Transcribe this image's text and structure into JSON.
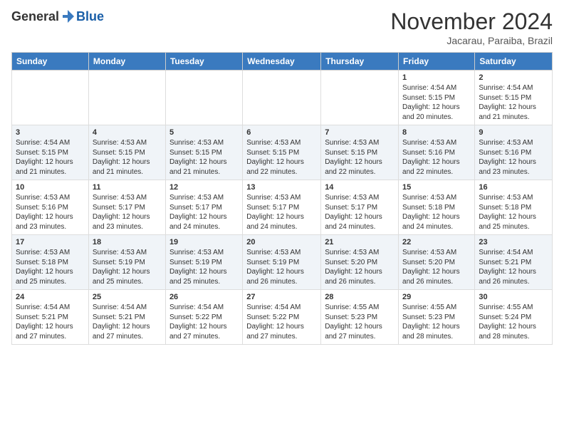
{
  "header": {
    "logo_general": "General",
    "logo_blue": "Blue",
    "month_title": "November 2024",
    "location": "Jacarau, Paraiba, Brazil"
  },
  "weekdays": [
    "Sunday",
    "Monday",
    "Tuesday",
    "Wednesday",
    "Thursday",
    "Friday",
    "Saturday"
  ],
  "weeks": [
    [
      {
        "day": "",
        "info": ""
      },
      {
        "day": "",
        "info": ""
      },
      {
        "day": "",
        "info": ""
      },
      {
        "day": "",
        "info": ""
      },
      {
        "day": "",
        "info": ""
      },
      {
        "day": "1",
        "info": "Sunrise: 4:54 AM\nSunset: 5:15 PM\nDaylight: 12 hours\nand 20 minutes."
      },
      {
        "day": "2",
        "info": "Sunrise: 4:54 AM\nSunset: 5:15 PM\nDaylight: 12 hours\nand 21 minutes."
      }
    ],
    [
      {
        "day": "3",
        "info": "Sunrise: 4:54 AM\nSunset: 5:15 PM\nDaylight: 12 hours\nand 21 minutes."
      },
      {
        "day": "4",
        "info": "Sunrise: 4:53 AM\nSunset: 5:15 PM\nDaylight: 12 hours\nand 21 minutes."
      },
      {
        "day": "5",
        "info": "Sunrise: 4:53 AM\nSunset: 5:15 PM\nDaylight: 12 hours\nand 21 minutes."
      },
      {
        "day": "6",
        "info": "Sunrise: 4:53 AM\nSunset: 5:15 PM\nDaylight: 12 hours\nand 22 minutes."
      },
      {
        "day": "7",
        "info": "Sunrise: 4:53 AM\nSunset: 5:15 PM\nDaylight: 12 hours\nand 22 minutes."
      },
      {
        "day": "8",
        "info": "Sunrise: 4:53 AM\nSunset: 5:16 PM\nDaylight: 12 hours\nand 22 minutes."
      },
      {
        "day": "9",
        "info": "Sunrise: 4:53 AM\nSunset: 5:16 PM\nDaylight: 12 hours\nand 23 minutes."
      }
    ],
    [
      {
        "day": "10",
        "info": "Sunrise: 4:53 AM\nSunset: 5:16 PM\nDaylight: 12 hours\nand 23 minutes."
      },
      {
        "day": "11",
        "info": "Sunrise: 4:53 AM\nSunset: 5:17 PM\nDaylight: 12 hours\nand 23 minutes."
      },
      {
        "day": "12",
        "info": "Sunrise: 4:53 AM\nSunset: 5:17 PM\nDaylight: 12 hours\nand 24 minutes."
      },
      {
        "day": "13",
        "info": "Sunrise: 4:53 AM\nSunset: 5:17 PM\nDaylight: 12 hours\nand 24 minutes."
      },
      {
        "day": "14",
        "info": "Sunrise: 4:53 AM\nSunset: 5:17 PM\nDaylight: 12 hours\nand 24 minutes."
      },
      {
        "day": "15",
        "info": "Sunrise: 4:53 AM\nSunset: 5:18 PM\nDaylight: 12 hours\nand 24 minutes."
      },
      {
        "day": "16",
        "info": "Sunrise: 4:53 AM\nSunset: 5:18 PM\nDaylight: 12 hours\nand 25 minutes."
      }
    ],
    [
      {
        "day": "17",
        "info": "Sunrise: 4:53 AM\nSunset: 5:18 PM\nDaylight: 12 hours\nand 25 minutes."
      },
      {
        "day": "18",
        "info": "Sunrise: 4:53 AM\nSunset: 5:19 PM\nDaylight: 12 hours\nand 25 minutes."
      },
      {
        "day": "19",
        "info": "Sunrise: 4:53 AM\nSunset: 5:19 PM\nDaylight: 12 hours\nand 25 minutes."
      },
      {
        "day": "20",
        "info": "Sunrise: 4:53 AM\nSunset: 5:19 PM\nDaylight: 12 hours\nand 26 minutes."
      },
      {
        "day": "21",
        "info": "Sunrise: 4:53 AM\nSunset: 5:20 PM\nDaylight: 12 hours\nand 26 minutes."
      },
      {
        "day": "22",
        "info": "Sunrise: 4:53 AM\nSunset: 5:20 PM\nDaylight: 12 hours\nand 26 minutes."
      },
      {
        "day": "23",
        "info": "Sunrise: 4:54 AM\nSunset: 5:21 PM\nDaylight: 12 hours\nand 26 minutes."
      }
    ],
    [
      {
        "day": "24",
        "info": "Sunrise: 4:54 AM\nSunset: 5:21 PM\nDaylight: 12 hours\nand 27 minutes."
      },
      {
        "day": "25",
        "info": "Sunrise: 4:54 AM\nSunset: 5:21 PM\nDaylight: 12 hours\nand 27 minutes."
      },
      {
        "day": "26",
        "info": "Sunrise: 4:54 AM\nSunset: 5:22 PM\nDaylight: 12 hours\nand 27 minutes."
      },
      {
        "day": "27",
        "info": "Sunrise: 4:54 AM\nSunset: 5:22 PM\nDaylight: 12 hours\nand 27 minutes."
      },
      {
        "day": "28",
        "info": "Sunrise: 4:55 AM\nSunset: 5:23 PM\nDaylight: 12 hours\nand 27 minutes."
      },
      {
        "day": "29",
        "info": "Sunrise: 4:55 AM\nSunset: 5:23 PM\nDaylight: 12 hours\nand 28 minutes."
      },
      {
        "day": "30",
        "info": "Sunrise: 4:55 AM\nSunset: 5:24 PM\nDaylight: 12 hours\nand 28 minutes."
      }
    ]
  ]
}
